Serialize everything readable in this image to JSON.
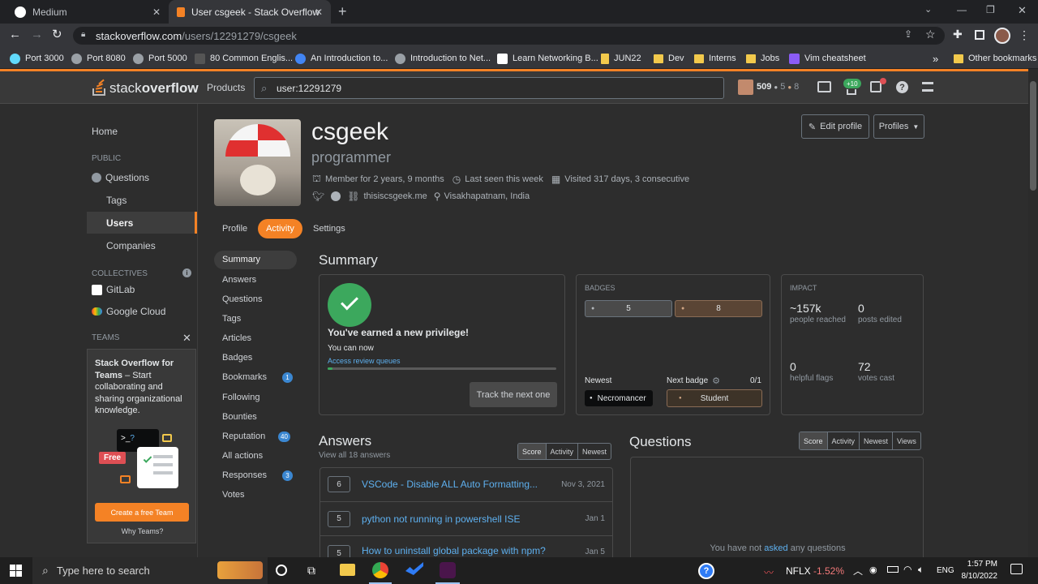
{
  "browser": {
    "tabs": [
      {
        "title": "Medium"
      },
      {
        "title": "User csgeek - Stack Overflow"
      }
    ],
    "url_domain": "stackoverflow.com",
    "url_path": "/users/12291279/csgeek",
    "bookmarks": [
      "Port 3000",
      "Port 8080",
      "Port 5000",
      "80 Common Englis...",
      "An Introduction to...",
      "Introduction to Net...",
      "Learn Networking B...",
      "JUN22",
      "Dev",
      "Interns",
      "Jobs",
      "Vim cheatsheet"
    ],
    "bookmarks_more": "»",
    "other_bookmarks": "Other bookmarks"
  },
  "so_header": {
    "logo_text_1": "stack",
    "logo_text_2": "overflow",
    "products": "Products",
    "search_value": "user:12291279",
    "reputation": "509",
    "silver_count": "5",
    "bronze_count": "8",
    "achievements_badge": "+10"
  },
  "leftnav": {
    "home": "Home",
    "public_label": "PUBLIC",
    "questions": "Questions",
    "tags": "Tags",
    "users": "Users",
    "companies": "Companies",
    "collectives_label": "COLLECTIVES",
    "gitlab": "GitLab",
    "google_cloud": "Google Cloud",
    "teams_label": "TEAMS",
    "teams_title": "Stack Overflow for Teams",
    "teams_desc": " – Start collaborating and sharing organizational knowledge.",
    "free_label": "Free",
    "create_team": "Create a free Team",
    "why_teams": "Why Teams?"
  },
  "profile": {
    "name": "csgeek",
    "role": "programmer",
    "member_for": "Member for 2 years, 9 months",
    "last_seen": "Last seen this week",
    "visited": "Visited 317 days, 3 consecutive",
    "website": "thisiscsgeek.me",
    "location": "Visakhapatnam, India",
    "edit_profile": "Edit profile",
    "profiles": "Profiles"
  },
  "profile_tabs": [
    "Profile",
    "Activity",
    "Settings"
  ],
  "subnav": [
    {
      "label": "Summary"
    },
    {
      "label": "Answers"
    },
    {
      "label": "Questions"
    },
    {
      "label": "Tags"
    },
    {
      "label": "Articles"
    },
    {
      "label": "Badges"
    },
    {
      "label": "Bookmarks",
      "count": "1"
    },
    {
      "label": "Following"
    },
    {
      "label": "Bounties"
    },
    {
      "label": "Reputation",
      "count": "40"
    },
    {
      "label": "All actions"
    },
    {
      "label": "Responses",
      "count": "3"
    },
    {
      "label": "Votes"
    }
  ],
  "summary": {
    "title": "Summary",
    "privilege_title": "You've earned a new privilege!",
    "you_can_now": "You can now",
    "privilege_link": "Access review queues",
    "track_next": "Track the next one",
    "badges_label": "BADGES",
    "silver_badges": "5",
    "bronze_badges": "8",
    "newest_label": "Newest",
    "newest_badge": "Necromancer",
    "next_badge_label": "Next badge",
    "next_badge_progress": "0/1",
    "next_badge": "Student",
    "impact_label": "IMPACT",
    "people_reached": "~157k",
    "people_reached_label": "people reached",
    "posts_edited": "0",
    "posts_edited_label": "posts edited",
    "helpful_flags": "0",
    "helpful_flags_label": "helpful flags",
    "votes_cast": "72",
    "votes_cast_label": "votes cast"
  },
  "answers": {
    "title": "Answers",
    "view_all": "View all 18 answers",
    "sort": [
      "Score",
      "Activity",
      "Newest"
    ],
    "items": [
      {
        "score": "6",
        "title": "VSCode - Disable ALL Auto Formatting...",
        "date": "Nov 3, 2021"
      },
      {
        "score": "5",
        "title": "python not running in powershell ISE",
        "date": "Jan 1"
      },
      {
        "score": "5",
        "title": "How to uninstall global package with npm?",
        "date": "Jan 5"
      }
    ]
  },
  "questions": {
    "title": "Questions",
    "sort": [
      "Score",
      "Activity",
      "Newest",
      "Views"
    ],
    "empty_1": "You have not ",
    "empty_link": "asked",
    "empty_2": " any questions"
  },
  "taskbar": {
    "search": "Type here to search",
    "stock": "NFLX",
    "stock_change": "-1.52%",
    "lang": "ENG",
    "time": "1:57 PM",
    "date": "8/10/2022"
  },
  "colors": {
    "accent": "#f48225",
    "link": "#5eb0ef",
    "success": "#3ca85d"
  }
}
